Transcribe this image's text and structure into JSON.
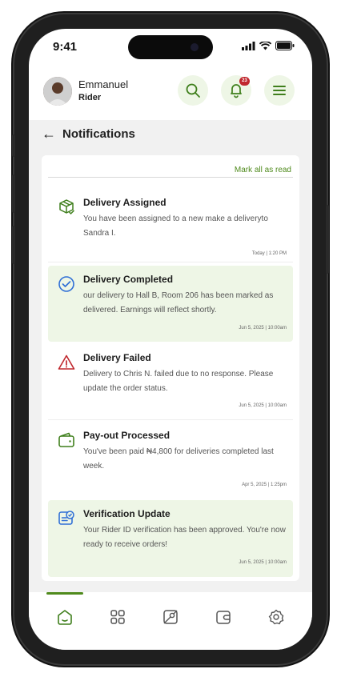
{
  "status": {
    "time": "9:41"
  },
  "user": {
    "name": "Emmanuel",
    "role": "Rider"
  },
  "header": {
    "notification_count": "23"
  },
  "page": {
    "back_arrow": "←",
    "title": "Notifications",
    "mark_all_label": "Mark all as read"
  },
  "notifications": [
    {
      "title": "Delivery Assigned",
      "body": "You have been assigned to a new make a deliveryto Sandra I.",
      "date": "Today | 1:20 PM",
      "icon": "package-check-icon",
      "highlight": false
    },
    {
      "title": "Delivery Completed",
      "body": "our delivery to Hall B, Room 206 has been marked as delivered. Earnings will reflect shortly.",
      "date": "Jun 5, 2025 | 10:00am",
      "icon": "check-circle-icon",
      "highlight": true
    },
    {
      "title": "Delivery Failed",
      "body": " Delivery to Chris N. failed due to no response. Please update the order status.",
      "date": "Jun 5, 2025 | 10:00am",
      "icon": "warning-triangle-icon",
      "highlight": false
    },
    {
      "title": "Pay-out Processed",
      "body": "You've been paid ₦4,800 for deliveries completed last week.",
      "date": "Apr 5, 2025 | 1:25pm",
      "icon": "wallet-icon",
      "highlight": false
    },
    {
      "title": "Verification Update",
      "body": "Your Rider ID verification has been approved. You're now ready to receive orders!",
      "date": "Jun 5, 2025 | 10:00am",
      "icon": "id-verified-icon",
      "highlight": true
    }
  ],
  "nav": [
    "home-icon",
    "grid-icon",
    "map-icon",
    "wallet-icon",
    "settings-icon"
  ],
  "colors": {
    "accent": "#4f8a1c",
    "highlight_bg": "#eef6e6",
    "alert": "#c0282e",
    "info": "#2f6fd6"
  }
}
